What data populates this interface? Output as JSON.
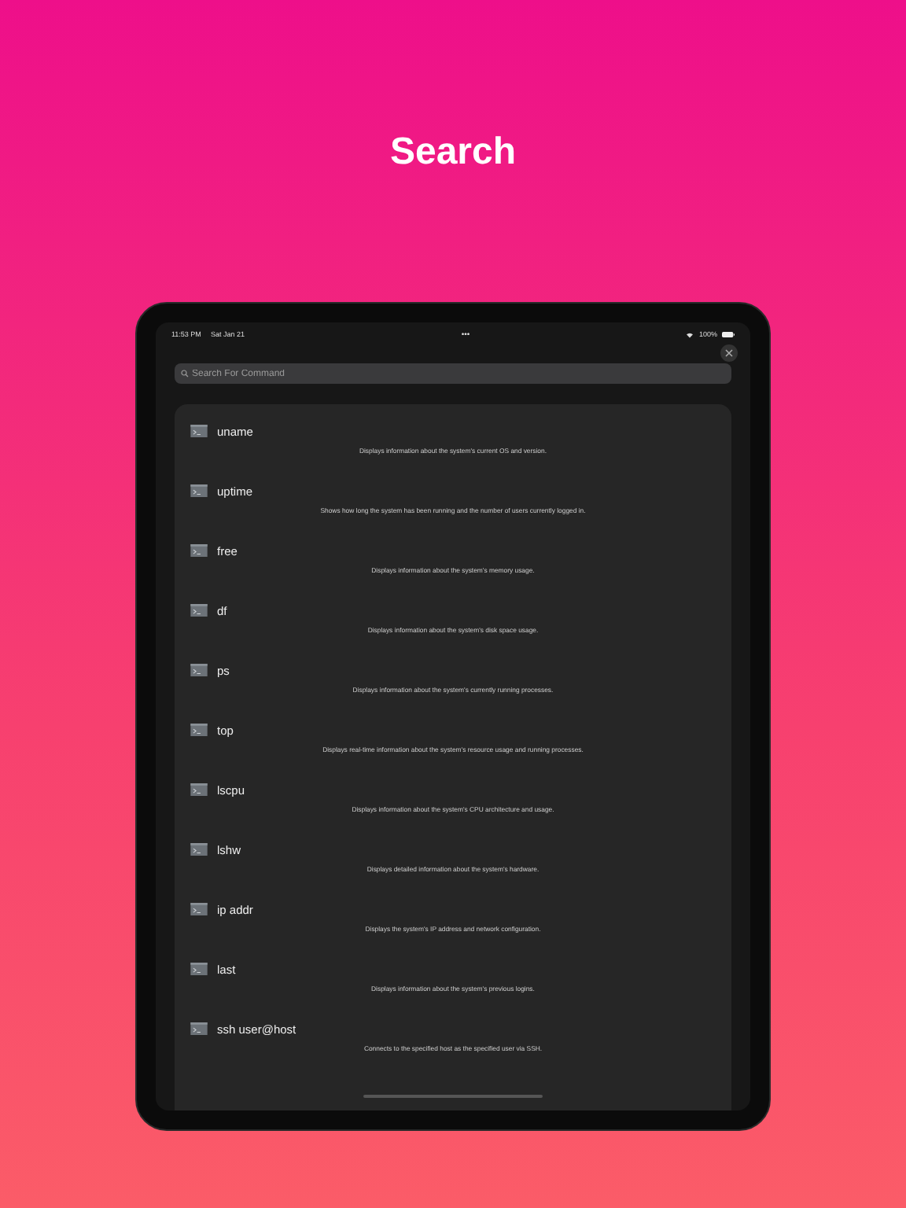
{
  "headline": "Search",
  "status_bar": {
    "time": "11:53 PM",
    "date": "Sat Jan 21",
    "dots": "•••",
    "battery": "100%"
  },
  "search": {
    "placeholder": "Search For Command"
  },
  "commands": [
    {
      "name": "uname",
      "description": "Displays information about the system's current OS and version."
    },
    {
      "name": "uptime",
      "description": "Shows how long the system has been running and the number of users currently logged in."
    },
    {
      "name": "free",
      "description": "Displays information about the system's memory usage."
    },
    {
      "name": "df",
      "description": "Displays information about the system's disk space usage."
    },
    {
      "name": "ps",
      "description": "Displays information about the system's currently running processes."
    },
    {
      "name": "top",
      "description": "Displays real-time information about the system's resource usage and running processes."
    },
    {
      "name": "lscpu",
      "description": "Displays information about the system's CPU architecture and usage."
    },
    {
      "name": "lshw",
      "description": "Displays detailed information about the system's hardware."
    },
    {
      "name": "ip addr",
      "description": "Displays the system's IP address and network configuration."
    },
    {
      "name": "last",
      "description": "Displays information about the system's previous logins."
    },
    {
      "name": "ssh user@host",
      "description": "Connects to the specified host as the specified user via SSH."
    }
  ]
}
